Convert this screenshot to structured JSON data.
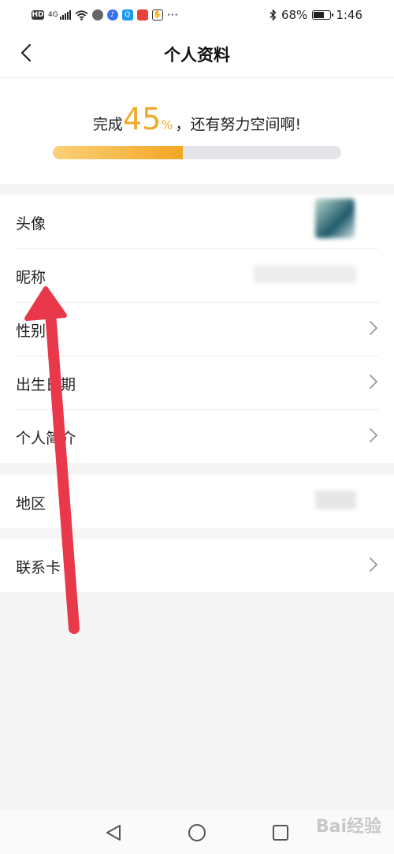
{
  "status_bar": {
    "hd": "HD",
    "network": "4G",
    "more": "···",
    "battery_percent": "68%",
    "battery_level": 0.68,
    "time": "1:46"
  },
  "header": {
    "title": "个人资料",
    "back_icon": "chevron-left-icon"
  },
  "completion": {
    "prefix": "完成",
    "percent_value": "45",
    "percent_sign": "%",
    "suffix": "，还有努力空间啊!",
    "progress": 0.45,
    "bar_start_color": "#fad17a",
    "bar_end_color": "#f3a623",
    "accent_color": "#f0a92a"
  },
  "groups": [
    {
      "items": [
        {
          "label": "头像",
          "has_chevron": false
        },
        {
          "label": "昵称",
          "has_chevron": false
        },
        {
          "label": "性别",
          "has_chevron": true
        },
        {
          "label": "出生日期",
          "has_chevron": true
        },
        {
          "label": "个人简介",
          "has_chevron": true
        }
      ]
    },
    {
      "items": [
        {
          "label": "地区",
          "has_chevron": false
        }
      ]
    },
    {
      "items": [
        {
          "label": "联系卡",
          "has_chevron": true
        }
      ]
    }
  ],
  "annotation": {
    "arrow_color": "#e8384a"
  },
  "navbar": {
    "back_icon": "triangle-back-icon",
    "home_icon": "circle-home-icon",
    "recent_icon": "square-recent-icon"
  },
  "watermark": "Bai经验"
}
